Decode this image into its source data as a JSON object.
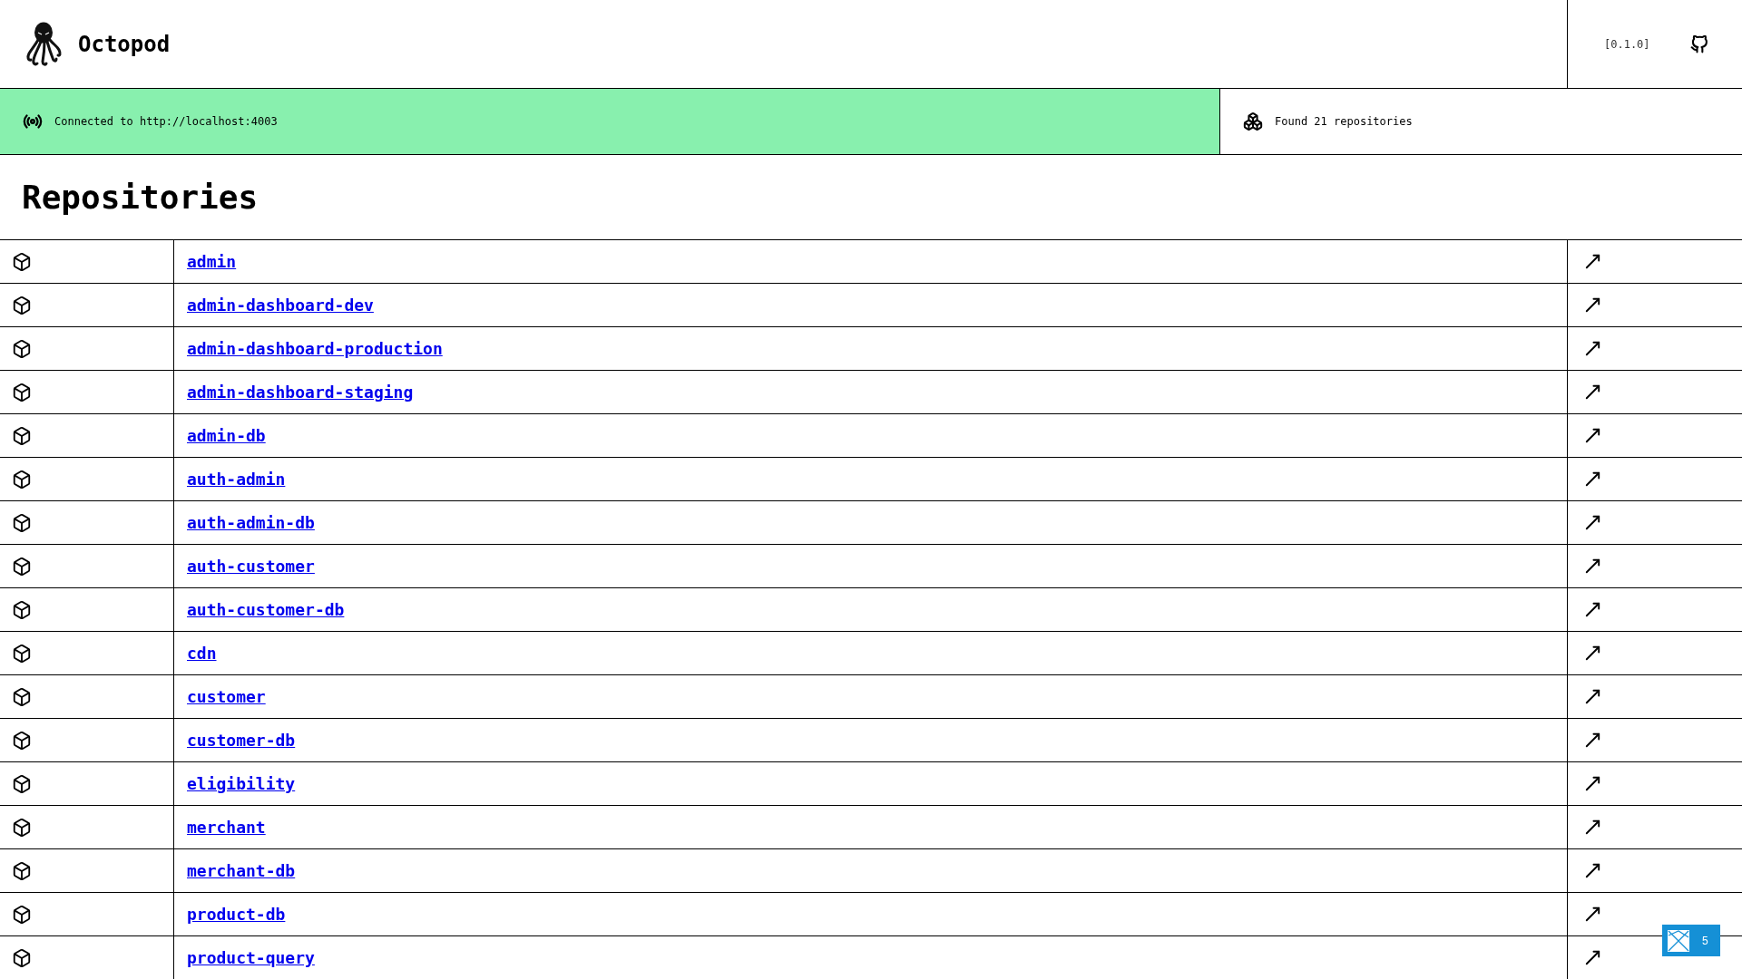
{
  "header": {
    "title": "Octopod",
    "version": "[0.1.0]"
  },
  "status": {
    "connection": {
      "text": "Connected to http://localhost:4003",
      "connected": true
    },
    "summary": {
      "text": "Found 21 repositories"
    }
  },
  "page_title": "Repositories",
  "repositories": [
    {
      "name": "admin"
    },
    {
      "name": "admin-dashboard-dev"
    },
    {
      "name": "admin-dashboard-production"
    },
    {
      "name": "admin-dashboard-staging"
    },
    {
      "name": "admin-db"
    },
    {
      "name": "auth-admin"
    },
    {
      "name": "auth-admin-db"
    },
    {
      "name": "auth-customer"
    },
    {
      "name": "auth-customer-db"
    },
    {
      "name": "cdn"
    },
    {
      "name": "customer"
    },
    {
      "name": "customer-db"
    },
    {
      "name": "eligibility"
    },
    {
      "name": "merchant"
    },
    {
      "name": "merchant-db"
    },
    {
      "name": "product-db"
    },
    {
      "name": "product-query"
    }
  ],
  "notification_badge": {
    "count": "5"
  }
}
